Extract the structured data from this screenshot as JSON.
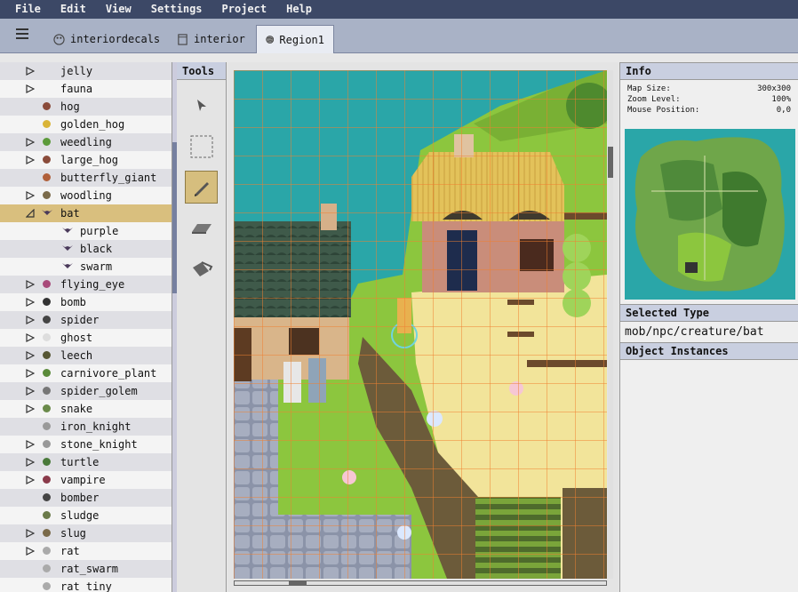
{
  "menu": [
    "File",
    "Edit",
    "View",
    "Settings",
    "Project",
    "Help"
  ],
  "tabs": [
    {
      "label": "interiordecals",
      "icon": "palette-icon"
    },
    {
      "label": "interior",
      "icon": "document-icon"
    },
    {
      "label": "Region1",
      "icon": "globe-icon",
      "active": true
    }
  ],
  "tree": [
    {
      "label": "jelly",
      "arrow": "right",
      "icon": ""
    },
    {
      "label": "fauna",
      "arrow": "right",
      "icon": ""
    },
    {
      "label": "hog",
      "arrow": "",
      "icon": "hog"
    },
    {
      "label": "golden_hog",
      "arrow": "",
      "icon": "golden_hog"
    },
    {
      "label": "weedling",
      "arrow": "right",
      "icon": "weedling"
    },
    {
      "label": "large_hog",
      "arrow": "right",
      "icon": "large_hog"
    },
    {
      "label": "butterfly_giant",
      "arrow": "",
      "icon": "butterfly"
    },
    {
      "label": "woodling",
      "arrow": "right",
      "icon": "woodling"
    },
    {
      "label": "bat",
      "arrow": "down",
      "icon": "bat",
      "selected": true
    },
    {
      "label": "purple",
      "arrow": "",
      "icon": "bat",
      "child": true
    },
    {
      "label": "black",
      "arrow": "",
      "icon": "bat",
      "child": true
    },
    {
      "label": "swarm",
      "arrow": "",
      "icon": "bat",
      "child": true
    },
    {
      "label": "flying_eye",
      "arrow": "right",
      "icon": "flying_eye"
    },
    {
      "label": "bomb",
      "arrow": "right",
      "icon": "bomb"
    },
    {
      "label": "spider",
      "arrow": "right",
      "icon": "spider"
    },
    {
      "label": "ghost",
      "arrow": "right",
      "icon": "ghost"
    },
    {
      "label": "leech",
      "arrow": "right",
      "icon": "leech"
    },
    {
      "label": "carnivore_plant",
      "arrow": "right",
      "icon": "plant"
    },
    {
      "label": "spider_golem",
      "arrow": "right",
      "icon": "spider_golem"
    },
    {
      "label": "snake",
      "arrow": "right",
      "icon": "snake"
    },
    {
      "label": "iron_knight",
      "arrow": "",
      "icon": "knight"
    },
    {
      "label": "stone_knight",
      "arrow": "right",
      "icon": "knight"
    },
    {
      "label": "turtle",
      "arrow": "right",
      "icon": "turtle"
    },
    {
      "label": "vampire",
      "arrow": "right",
      "icon": "vampire"
    },
    {
      "label": "bomber",
      "arrow": "",
      "icon": "bomber"
    },
    {
      "label": "sludge",
      "arrow": "",
      "icon": "sludge"
    },
    {
      "label": "slug",
      "arrow": "right",
      "icon": "slug"
    },
    {
      "label": "rat",
      "arrow": "right",
      "icon": "rat"
    },
    {
      "label": "rat_swarm",
      "arrow": "",
      "icon": "rat"
    },
    {
      "label": "rat_tiny",
      "arrow": "",
      "icon": "rat"
    }
  ],
  "tools": {
    "title": "Tools",
    "items": [
      "pointer-icon",
      "selection-icon",
      "pencil-icon",
      "eraser-icon",
      "bucket-icon"
    ],
    "active": "pencil-icon"
  },
  "info": {
    "title": "Info",
    "map_size_label": "Map Size:",
    "map_size": "300x300",
    "zoom_label": "Zoom Level:",
    "zoom": "100%",
    "mouse_label": "Mouse Position:",
    "mouse": "0,0",
    "selected_type_title": "Selected Type",
    "selected_type": "mob/npc/creature/bat",
    "object_instances_title": "Object Instances"
  },
  "colors": {
    "menubar": "#3c4866",
    "tabbar": "#a9b2c6",
    "selected": "#d9bf7e",
    "panel_head": "#c9cfe0",
    "water": "#2aa6a8",
    "grass": "#8cc63e",
    "grid": "#f08030"
  }
}
